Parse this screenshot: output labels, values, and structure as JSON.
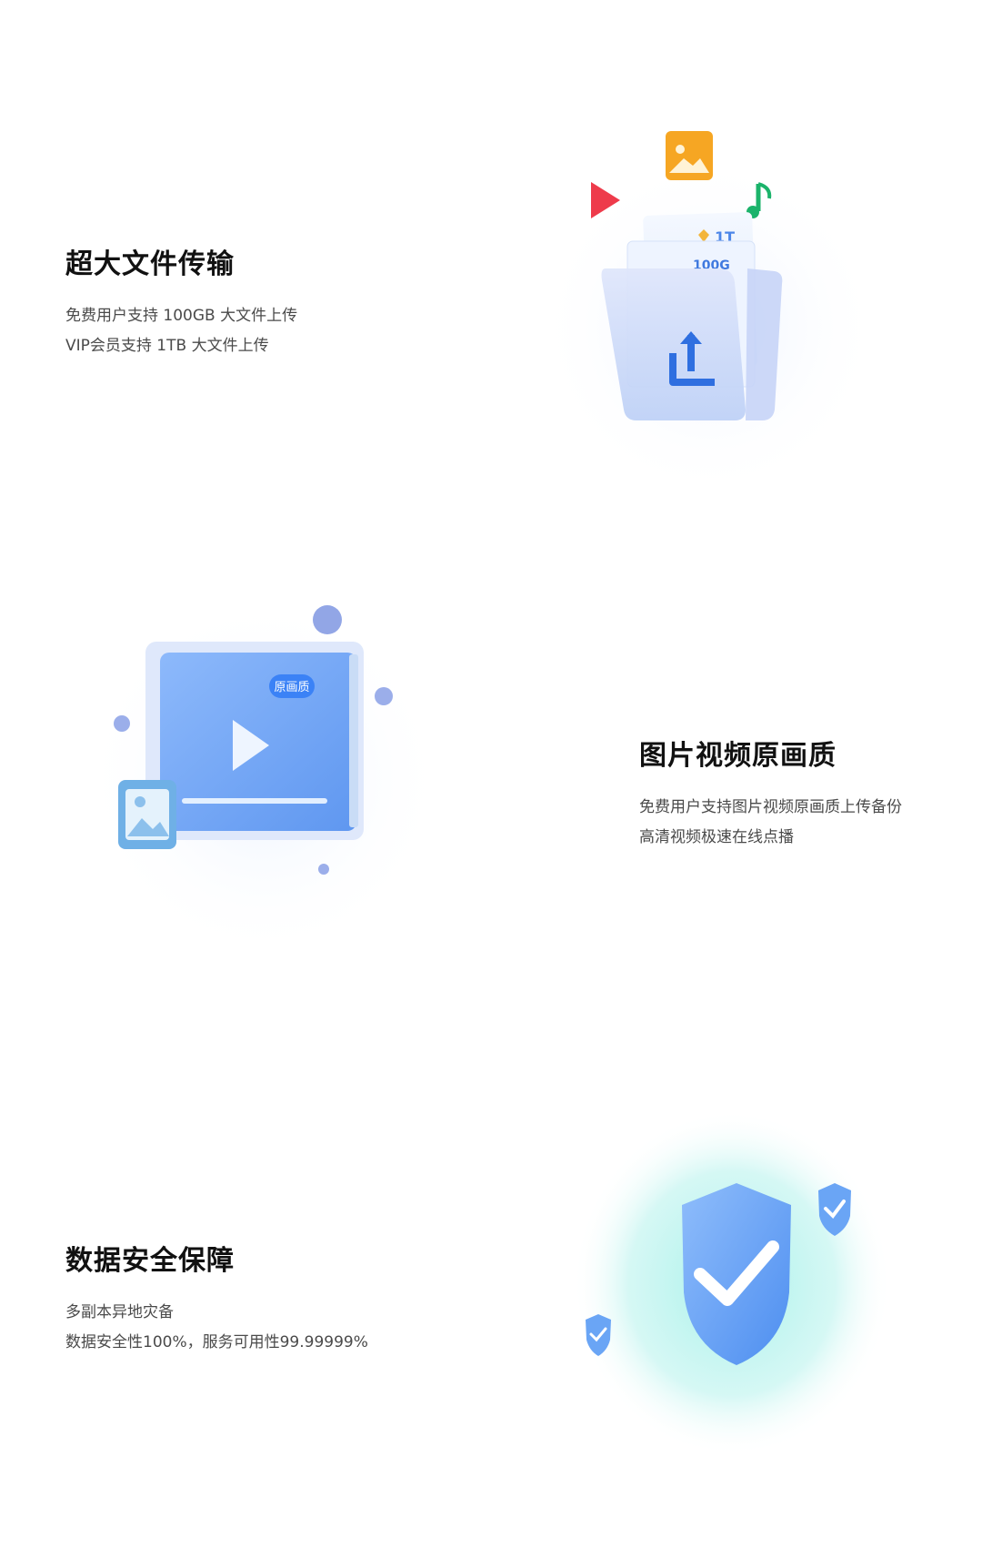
{
  "features": [
    {
      "title": "超大文件传输",
      "lines": [
        "免费用户支持 100GB 大文件上传",
        "VIP会员支持 1TB 大文件上传"
      ],
      "illustration": {
        "icons": [
          "image-file-icon",
          "play-icon",
          "music-note-icon",
          "upload-icon",
          "diamond-icon"
        ],
        "tag_large": "1T",
        "tag_small": "100G",
        "colors": {
          "folder": "#b9c9f5",
          "image": "#f6a623",
          "play": "#ee3b4b",
          "music": "#1bb36b",
          "upload": "#2f6fe0"
        }
      }
    },
    {
      "title": "图片视频原画质",
      "lines": [
        "免费用户支持图片视频原画质上传备份",
        "高清视频极速在线点播"
      ],
      "illustration": {
        "icons": [
          "video-player-icon",
          "play-icon",
          "image-icon"
        ],
        "badge": "原画质",
        "colors": {
          "screen": "#6fa6f5",
          "badge": "#3b82f6"
        }
      }
    },
    {
      "title": "数据安全保障",
      "lines": [
        "多副本异地灾备",
        "数据安全性100%，服务可用性99.99999%"
      ],
      "illustration": {
        "icons": [
          "shield-check-icon"
        ],
        "colors": {
          "glow": "#bff3ee",
          "shield": "#5b9cf6"
        }
      }
    }
  ]
}
